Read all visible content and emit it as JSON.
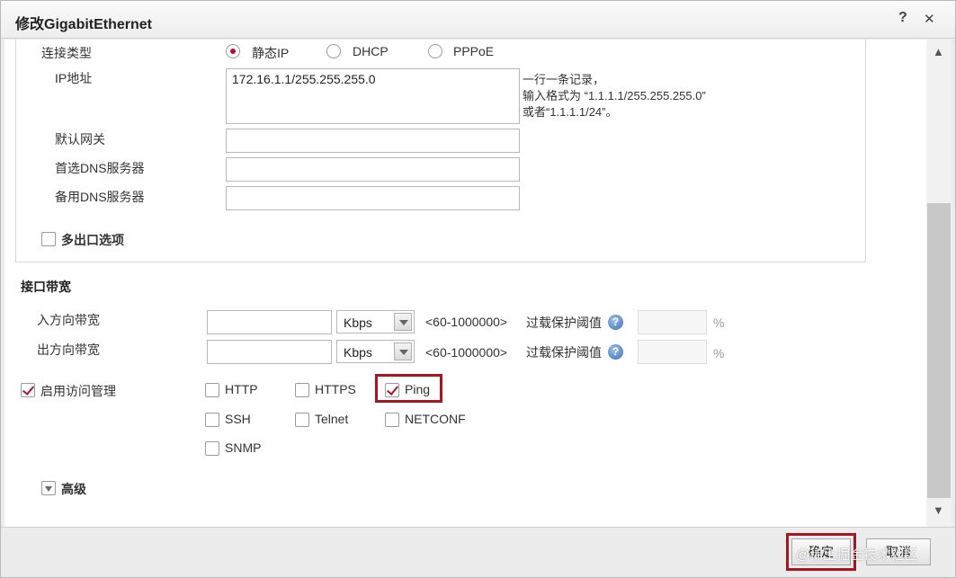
{
  "dialog": {
    "title": "修改GigabitEthernet",
    "help_label": "?",
    "close_label": "✕"
  },
  "connection": {
    "type_label": "连接类型",
    "options": [
      {
        "label": "静态IP",
        "selected": true
      },
      {
        "label": "DHCP",
        "selected": false
      },
      {
        "label": "PPPoE",
        "selected": false
      }
    ],
    "ip_label": "IP地址",
    "ip_value": "172.16.1.1/255.255.255.0",
    "ip_hint": [
      "一行一条记录，",
      "输入格式为 “1.1.1.1/255.255.255.0”",
      "或者“1.1.1.1/24”。"
    ],
    "gateway_label": "默认网关",
    "gateway_value": "",
    "dns1_label": "首选DNS服务器",
    "dns1_value": "",
    "dns2_label": "备用DNS服务器",
    "dns2_value": "",
    "multi_exit_label": "多出口选项",
    "multi_exit_checked": false
  },
  "bandwidth": {
    "title": "接口带宽",
    "rows": [
      {
        "label": "入方向带宽",
        "value": "",
        "unit": "Kbps",
        "range": "<60-1000000>",
        "overload_label": "过载保护阈值",
        "threshold": "",
        "percent": "%"
      },
      {
        "label": "出方向带宽",
        "value": "",
        "unit": "Kbps",
        "range": "<60-1000000>",
        "overload_label": "过载保护阈值",
        "threshold": "",
        "percent": "%"
      }
    ]
  },
  "access": {
    "label": "启用访问管理",
    "checked": true,
    "services": [
      {
        "label": "HTTP",
        "checked": false
      },
      {
        "label": "HTTPS",
        "checked": false
      },
      {
        "label": "Ping",
        "checked": true
      },
      {
        "label": "SSH",
        "checked": false
      },
      {
        "label": "Telnet",
        "checked": false
      },
      {
        "label": "NETCONF",
        "checked": false
      },
      {
        "label": "SNMP",
        "checked": false
      }
    ]
  },
  "advanced": {
    "label": "高级"
  },
  "footer": {
    "ok_label": "确定",
    "cancel_label": "取消",
    "watermark": "@稀土掘金技术社区"
  },
  "colors": {
    "accent": "#b3112f",
    "highlight": "#a5161e"
  }
}
